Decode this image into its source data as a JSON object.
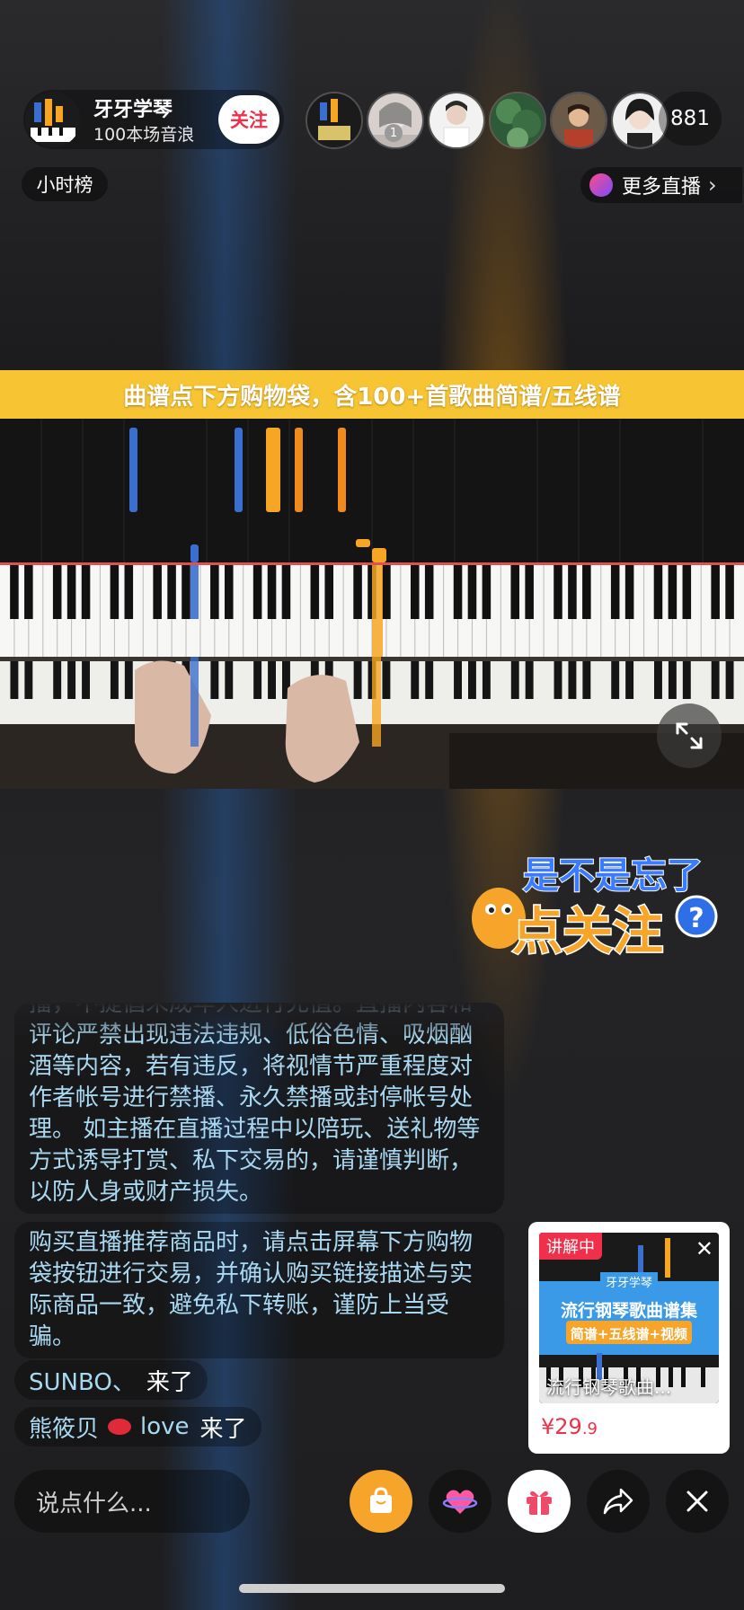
{
  "header": {
    "host_name": "牙牙学琴",
    "host_subtitle": "100本场音浪",
    "follow_label": "关注",
    "viewer_rank_badge": "1",
    "viewer_count": "881",
    "hour_rank_label": "小时榜",
    "more_live_label": "更多直播"
  },
  "banner": {
    "text": "曲谱点下方购物袋，含100+首歌曲简谱/五线谱"
  },
  "sticker": {
    "line1": "是不是忘了",
    "line2": "点关注",
    "mark": "?"
  },
  "comments": {
    "notice_1": "播，不提倡未成年人进行充值。直播内容和评论严禁出现违法违规、低俗色情、吸烟酗酒等内容，若有违反，将视情节严重程度对作者帐号进行禁播、永久禁播或封停帐号处理。 如主播在直播过程中以陪玩、送礼物等方式诱导打赏、私下交易的，请谨慎判断，以防人身或财产损失。",
    "notice_2": "购买直播推荐商品时，请点击屏幕下方购物袋按钮进行交易，并确认购买链接描述与实际商品一致，避免私下转账，谨防上当受骗。",
    "join_1_name": "SUNBO、",
    "join_1_action": "来了",
    "join_2_name": "熊筱贝",
    "join_2_name_suffix": "love",
    "join_2_action": "来了"
  },
  "product": {
    "badge": "讲解中",
    "thumb_brand": "牙牙学琴",
    "thumb_title": "流行钢琴歌曲谱集",
    "thumb_sub": "简谱+五线谱+视频",
    "caption": "流行钢琴歌曲...",
    "price_symbol": "¥",
    "price_main": "29",
    "price_decimal": ".9"
  },
  "bottom_bar": {
    "input_placeholder": "说点什么..."
  },
  "colors": {
    "accent_red": "#f0304a",
    "banner_yellow": "#f7c533",
    "comment_blue": "#a9d8f2",
    "shop_orange": "#f7a52a"
  }
}
